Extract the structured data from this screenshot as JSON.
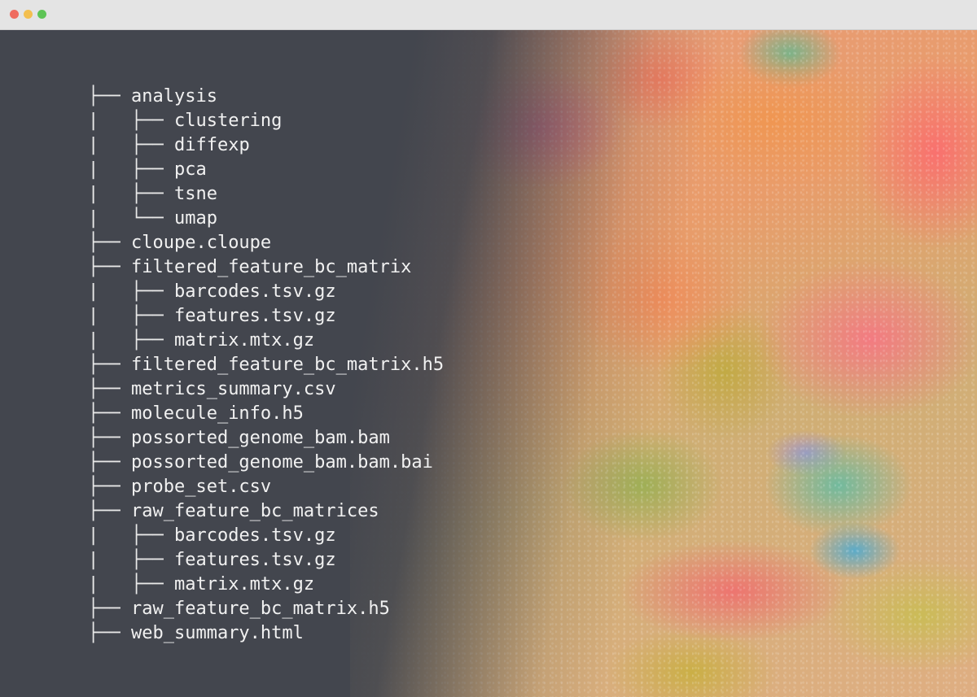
{
  "window": {
    "controls": [
      "close",
      "minimize",
      "maximize"
    ],
    "colors": {
      "titlebar": "#e4e4e4",
      "background": "#43464e",
      "text": "#f1f1f1",
      "close": "#ef6b5f",
      "minimize": "#f3bf4f",
      "maximize": "#5ec456"
    }
  },
  "tree": [
    {
      "prefix": "├── ",
      "name": "analysis"
    },
    {
      "prefix": "|   ├── ",
      "name": "clustering"
    },
    {
      "prefix": "|   ├── ",
      "name": "diffexp"
    },
    {
      "prefix": "|   ├── ",
      "name": "pca"
    },
    {
      "prefix": "|   ├── ",
      "name": "tsne"
    },
    {
      "prefix": "|   └── ",
      "name": "umap"
    },
    {
      "prefix": "├── ",
      "name": "cloupe.cloupe"
    },
    {
      "prefix": "├── ",
      "name": "filtered_feature_bc_matrix"
    },
    {
      "prefix": "|   ├── ",
      "name": "barcodes.tsv.gz"
    },
    {
      "prefix": "|   ├── ",
      "name": "features.tsv.gz"
    },
    {
      "prefix": "|   ├── ",
      "name": "matrix.mtx.gz"
    },
    {
      "prefix": "├── ",
      "name": "filtered_feature_bc_matrix.h5"
    },
    {
      "prefix": "├── ",
      "name": "metrics_summary.csv"
    },
    {
      "prefix": "├── ",
      "name": "molecule_info.h5"
    },
    {
      "prefix": "├── ",
      "name": "possorted_genome_bam.bam"
    },
    {
      "prefix": "├── ",
      "name": "possorted_genome_bam.bam.bai"
    },
    {
      "prefix": "├── ",
      "name": "probe_set.csv"
    },
    {
      "prefix": "├── ",
      "name": "raw_feature_bc_matrices"
    },
    {
      "prefix": "|   ├── ",
      "name": "barcodes.tsv.gz"
    },
    {
      "prefix": "|   ├── ",
      "name": "features.tsv.gz"
    },
    {
      "prefix": "|   ├── ",
      "name": "matrix.mtx.gz"
    },
    {
      "prefix": "├── ",
      "name": "raw_feature_bc_matrix.h5"
    },
    {
      "prefix": "├── ",
      "name": "web_summary.html"
    }
  ]
}
